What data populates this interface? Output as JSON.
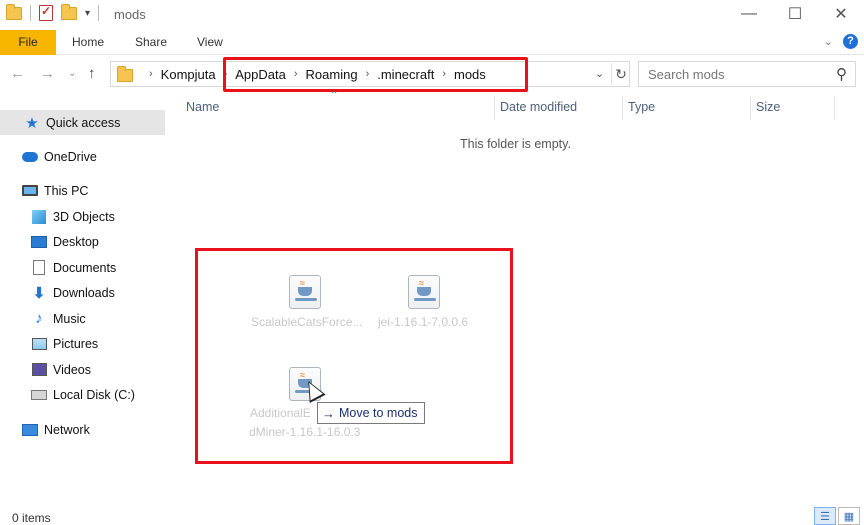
{
  "window": {
    "title": "mods"
  },
  "ribbon": {
    "tabs": [
      "File",
      "Home",
      "Share",
      "View"
    ]
  },
  "address": {
    "crumbs": [
      "Kompjuta",
      "AppData",
      "Roaming",
      ".minecraft",
      "mods"
    ],
    "search_placeholder": "Search mods"
  },
  "sidebar": {
    "quick_access": "Quick access",
    "onedrive": "OneDrive",
    "this_pc": "This PC",
    "items": [
      "3D Objects",
      "Desktop",
      "Documents",
      "Downloads",
      "Music",
      "Pictures",
      "Videos",
      "Local Disk (C:)"
    ],
    "network": "Network"
  },
  "columns": {
    "name": "Name",
    "date": "Date modified",
    "type": "Type",
    "size": "Size"
  },
  "content": {
    "empty_message": "This folder is empty."
  },
  "drag": {
    "files": [
      "ScalableCatsForce...",
      "jei-1.16.1-7.0.0.6",
      "AdditionalE",
      "dMiner-1.16.1-16.0.3"
    ],
    "tooltip": "Move to mods"
  },
  "status": {
    "items": "0 items"
  },
  "colors": {
    "highlight": "#e8111c",
    "file_tab": "#f7b500"
  }
}
